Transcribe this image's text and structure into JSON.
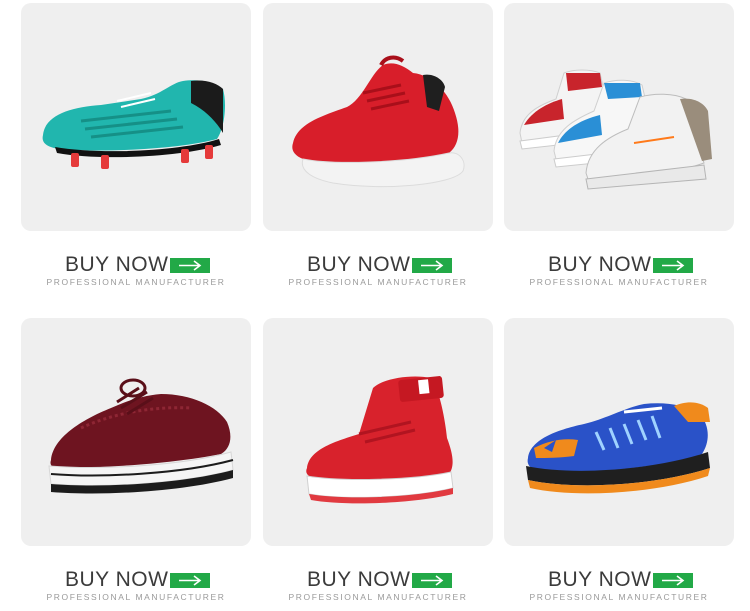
{
  "products": [
    {
      "name": "teal football cleat",
      "buy_label": "BUY NOW",
      "tagline": "PROFESSIONAL MANUFACTURER",
      "icon": "arrow-right-icon",
      "color": "#1fb7b0"
    },
    {
      "name": "red running sneaker",
      "buy_label": "BUY NOW",
      "tagline": "PROFESSIONAL MANUFACTURER",
      "icon": "arrow-right-icon",
      "color": "#d81e2a"
    },
    {
      "name": "high-top sneakers trio",
      "buy_label": "BUY NOW",
      "tagline": "PROFESSIONAL MANUFACTURER",
      "icon": "arrow-right-icon",
      "color": "#e8e8e8"
    },
    {
      "name": "burgundy patent brogue",
      "buy_label": "BUY NOW",
      "tagline": "PROFESSIONAL MANUFACTURER",
      "icon": "arrow-right-icon",
      "color": "#6e1420"
    },
    {
      "name": "red high-top sneaker",
      "buy_label": "BUY NOW",
      "tagline": "PROFESSIONAL MANUFACTURER",
      "icon": "arrow-right-icon",
      "color": "#d8222c"
    },
    {
      "name": "blue orange badminton shoe",
      "buy_label": "BUY NOW",
      "tagline": "PROFESSIONAL MANUFACTURER",
      "icon": "arrow-right-icon",
      "color": "#2a52c8"
    }
  ],
  "theme": {
    "tile_bg": "#efefef",
    "button_green": "#22a947",
    "text_dark": "#3b3b3b",
    "text_grey": "#9a9a9a"
  }
}
